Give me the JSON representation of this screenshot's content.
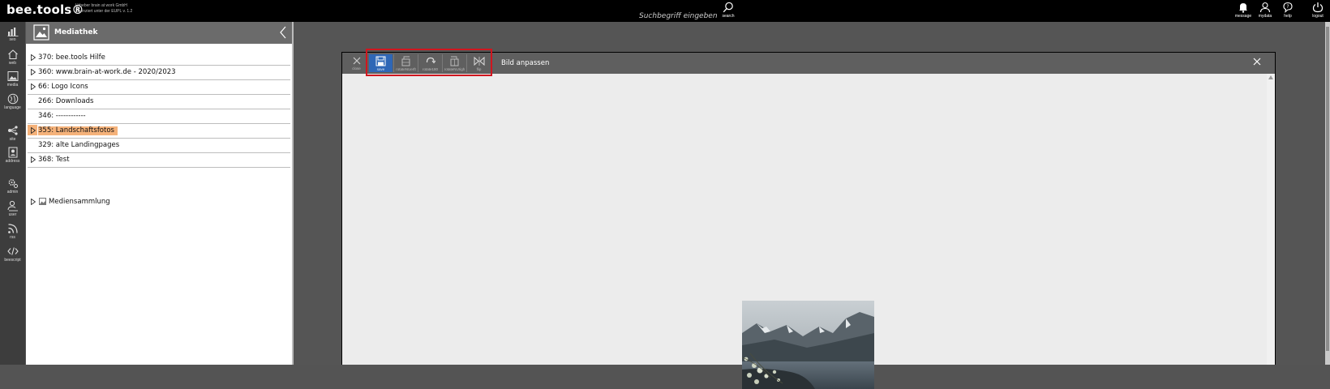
{
  "topbar": {
    "logo": "bee.tools®",
    "license_line1": "Urheber brain at work GmbH",
    "license_line2": "Lizenziert unter der EUPL v. 1.2",
    "search_placeholder": "Suchbegriff eingeben",
    "search_label": "search",
    "icons": [
      {
        "name": "message",
        "label": "message"
      },
      {
        "name": "mydata",
        "label": "mydata"
      },
      {
        "name": "help",
        "label": "help"
      },
      {
        "name": "logout",
        "label": "logout"
      }
    ]
  },
  "rail": {
    "items": [
      {
        "label": "seo"
      },
      {
        "label": "web"
      },
      {
        "label": "media"
      },
      {
        "label": "language"
      },
      {
        "label": "site"
      },
      {
        "label": "address"
      },
      {
        "label": "admin"
      },
      {
        "label": "user"
      },
      {
        "label": "rss"
      },
      {
        "label": "beescript"
      }
    ]
  },
  "panel": {
    "title": "Mediathek",
    "tree": [
      {
        "label": "370: bee.tools Hilfe",
        "expandable": true
      },
      {
        "label": "360: www.brain-at-work.de - 2020/2023",
        "expandable": true
      },
      {
        "label": "66: Logo Icons",
        "expandable": true
      },
      {
        "label": "266: Downloads",
        "expandable": false
      },
      {
        "label": "346: ------------",
        "expandable": false
      },
      {
        "label": "355: Landschaftsfotos",
        "expandable": true,
        "selected": true
      },
      {
        "label": "329: alte Landingpages",
        "expandable": false
      },
      {
        "label": "368: Test",
        "expandable": true
      }
    ],
    "collection_label": "Mediensammlung"
  },
  "dialog": {
    "title": "Bild anpassen",
    "toolbar": {
      "close": "close",
      "save": "save",
      "rotate_left": "rotateNUerft",
      "rotate180": "rotate180",
      "rotate_right": "rotateNUrigh",
      "flip": "flip"
    },
    "image_alt": "Mountain lake landscape"
  },
  "colors": {
    "highlight": "#f5b27a",
    "save_button": "#2f67b6",
    "red_outline": "#d0161f"
  }
}
